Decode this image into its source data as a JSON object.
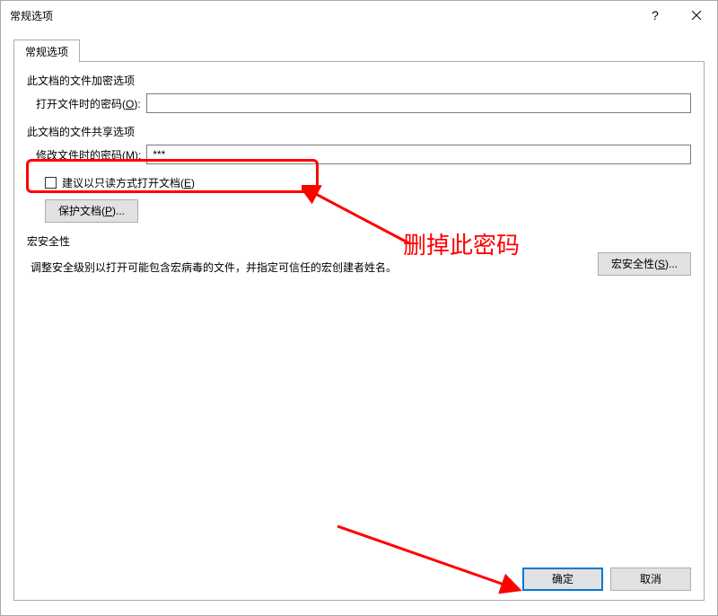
{
  "window": {
    "title": "常规选项"
  },
  "tabs": {
    "general": "常规选项"
  },
  "sections": {
    "encrypt_header": "此文档的文件加密选项",
    "open_password_label_prefix": "打开文件时的密码(",
    "open_password_key": "O",
    "open_password_label_suffix": "):",
    "open_password_value": "",
    "share_header": "此文档的文件共享选项",
    "modify_password_label_prefix": "修改文件时的密码(",
    "modify_password_key": "M",
    "modify_password_label_suffix": "):",
    "modify_password_value": "***",
    "readonly_label_prefix": "建议以只读方式打开文档(",
    "readonly_key": "E",
    "readonly_label_suffix": ")",
    "protect_btn_prefix": "保护文档(",
    "protect_btn_key": "P",
    "protect_btn_suffix": ")...",
    "macro_header": "宏安全性",
    "macro_desc": "调整安全级别以打开可能包含宏病毒的文件，并指定可信任的宏创建者姓名。",
    "macro_btn_prefix": "宏安全性(",
    "macro_btn_key": "S",
    "macro_btn_suffix": ")..."
  },
  "annotation": {
    "delete_password": "删掉此密码"
  },
  "buttons": {
    "ok": "确定",
    "cancel": "取消"
  }
}
